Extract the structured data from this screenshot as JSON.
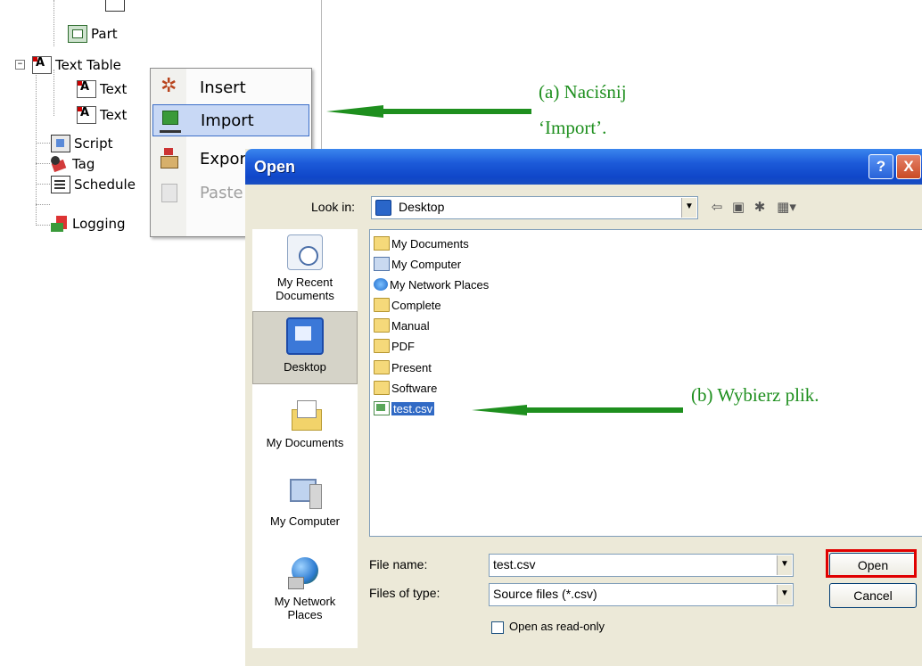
{
  "tree": {
    "items": [
      {
        "label": "Part"
      },
      {
        "label": "Text Table"
      },
      {
        "label": "Text"
      },
      {
        "label": "Text"
      },
      {
        "label": "Script"
      },
      {
        "label": "Tag"
      },
      {
        "label": "Schedule"
      },
      {
        "label": "Logging"
      }
    ],
    "expander_symbol": "−"
  },
  "context_menu": {
    "items": [
      {
        "label": "Insert",
        "icon": "insert-icon",
        "highlighted": false,
        "disabled": false
      },
      {
        "label": "Import",
        "icon": "import-icon",
        "highlighted": true,
        "disabled": false
      },
      {
        "label": "Export",
        "icon": "export-icon",
        "highlighted": false,
        "disabled": false
      },
      {
        "label": "Paste",
        "icon": "paste-icon",
        "highlighted": false,
        "disabled": true
      }
    ]
  },
  "dialog": {
    "title": "Open",
    "help_button": "?",
    "close_button": "X",
    "look_in_label": "Look in:",
    "look_in_value": "Desktop",
    "places": [
      {
        "label": "My Recent Documents",
        "icon": "recent-documents-icon",
        "selected": false
      },
      {
        "label": "Desktop",
        "icon": "desktop-icon",
        "selected": true
      },
      {
        "label": "My Documents",
        "icon": "my-documents-icon",
        "selected": false
      },
      {
        "label": "My Computer",
        "icon": "my-computer-icon",
        "selected": false
      },
      {
        "label": "My Network Places",
        "icon": "network-places-icon",
        "selected": false
      }
    ],
    "files": [
      {
        "name": "My Documents",
        "icon": "my-documents-icon",
        "selected": false
      },
      {
        "name": "My Computer",
        "icon": "my-computer-icon",
        "selected": false
      },
      {
        "name": "My Network Places",
        "icon": "network-places-icon",
        "selected": false
      },
      {
        "name": "Complete",
        "icon": "folder-icon",
        "selected": false
      },
      {
        "name": "Manual",
        "icon": "folder-icon",
        "selected": false
      },
      {
        "name": "PDF",
        "icon": "folder-icon",
        "selected": false
      },
      {
        "name": "Present",
        "icon": "folder-icon",
        "selected": false
      },
      {
        "name": "Software",
        "icon": "folder-icon",
        "selected": false
      },
      {
        "name": "test.csv",
        "icon": "csv-file-icon",
        "selected": true
      }
    ],
    "file_name_label": "File name:",
    "file_name_value": "test.csv",
    "file_type_label": "Files of type:",
    "file_type_value": "Source files (*.csv)",
    "open_button": "Open",
    "cancel_button": "Cancel",
    "readonly_label": "Open as read-only",
    "readonly_checked": false
  },
  "annotations": {
    "step_a_line1": "(a) Naciśnij",
    "step_a_line2": "‘Import’.",
    "step_b": "(b) Wybierz plik."
  },
  "colors": {
    "annotation": "#1e8f1e",
    "highlight_box": "#e00000",
    "menu_highlight": "#c8d8f5",
    "titlebar": "#0f46c9",
    "selection": "#316ac5"
  }
}
